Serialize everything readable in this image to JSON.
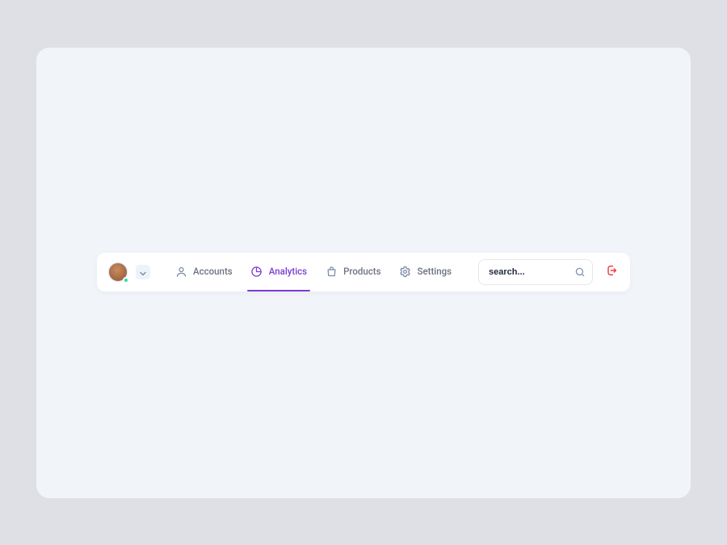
{
  "nav": {
    "items": [
      {
        "label": "Accounts"
      },
      {
        "label": "Analytics"
      },
      {
        "label": "Products"
      },
      {
        "label": "Settings"
      }
    ],
    "activeIndex": 1
  },
  "search": {
    "placeholder": "search..."
  },
  "colors": {
    "accent": "#7b3dcf",
    "muted": "#7b8aa8",
    "danger": "#ef3e3e",
    "status_online": "#2fd8a8"
  }
}
